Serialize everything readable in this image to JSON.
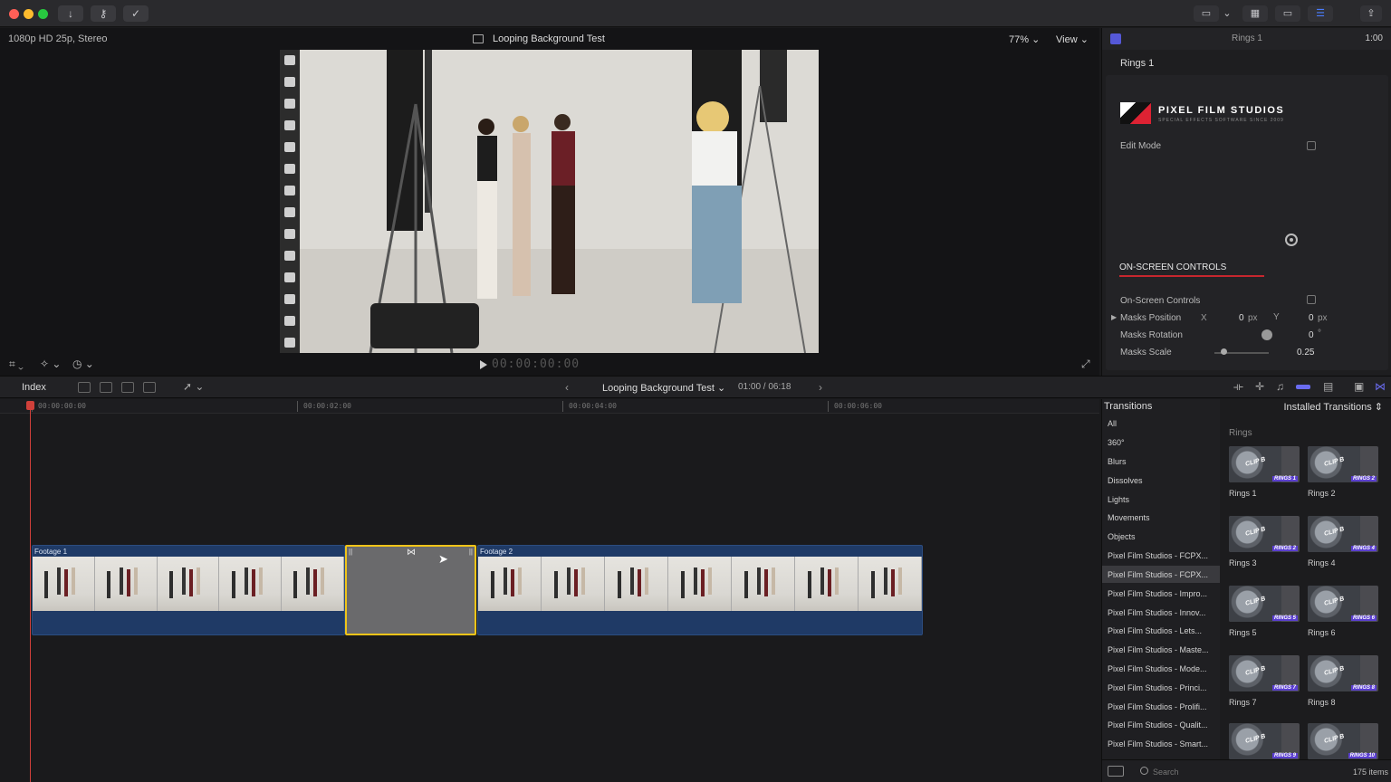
{
  "titlebar": {
    "colors": {
      "close": "#ff5f57",
      "minimize": "#febc2e",
      "maximize": "#28c840"
    }
  },
  "viewer": {
    "format": "1080p HD 25p, Stereo",
    "project_title": "Looping Background Test",
    "zoom": "77%",
    "view_label": "View",
    "timecode": "00:00:00:00"
  },
  "inspector": {
    "header_title": "Rings 1",
    "duration": "1:00",
    "clip_name": "Rings 1",
    "brand": "PIXEL FILM STUDIOS",
    "brand_sub": "SPECIAL EFFECTS SOFTWARE SINCE 2009",
    "edit_mode_label": "Edit Mode",
    "section_title": "ON-SCREEN CONTROLS",
    "on_screen_controls_label": "On-Screen Controls",
    "masks_position_label": "Masks Position",
    "x_label": "X",
    "x_value": "0",
    "y_label": "Y",
    "y_value": "0",
    "px_unit": "px",
    "masks_rotation_label": "Masks Rotation",
    "rotation_value": "0",
    "degree_unit": "°",
    "masks_scale_label": "Masks Scale",
    "scale_value": "0.25"
  },
  "timeline_toolbar": {
    "index_label": "Index",
    "project_name": "Looping Background Test",
    "time": "01:00 / 06:18"
  },
  "timeline": {
    "ruler": [
      "00:00:00:00",
      "00:00:02:00",
      "00:00:04:00",
      "00:00:06:00"
    ],
    "clip1_label": "Footage 1",
    "clip2_label": "Footage 2"
  },
  "browser": {
    "category_header": "Transitions",
    "grid_header": "Installed Transitions",
    "grid_section": "Rings",
    "categories": [
      "All",
      "360°",
      "Blurs",
      "Dissolves",
      "Lights",
      "Movements",
      "Objects",
      "Pixel Film Studios - FCPX...",
      "Pixel Film Studios - FCPX...",
      "Pixel Film Studios - Impro...",
      "Pixel Film Studios - Innov...",
      "Pixel Film Studios - Lets...",
      "Pixel Film Studios - Maste...",
      "Pixel Film Studios - Mode...",
      "Pixel Film Studios - Princi...",
      "Pixel Film Studios - Prolifi...",
      "Pixel Film Studios - Qualit...",
      "Pixel Film Studios - Smart..."
    ],
    "tiles": [
      {
        "name": "Rings 1",
        "tag": "RINGS 1",
        "clip": "CLIP B"
      },
      {
        "name": "Rings 2",
        "tag": "RINGS 2",
        "clip": "CLIP B"
      },
      {
        "name": "Rings 3",
        "tag": "RINGS 2",
        "clip": "CLIP B"
      },
      {
        "name": "Rings 4",
        "tag": "RINGS 4",
        "clip": "CLIP B"
      },
      {
        "name": "Rings 5",
        "tag": "RINGS 5",
        "clip": "CLIP B"
      },
      {
        "name": "Rings 6",
        "tag": "RINGS 6",
        "clip": "CLIP B"
      },
      {
        "name": "Rings 7",
        "tag": "RINGS 7",
        "clip": "CLIP B"
      },
      {
        "name": "Rings 8",
        "tag": "RINGS 8",
        "clip": "CLIP B"
      },
      {
        "name": "",
        "tag": "RINGS 9",
        "clip": "CLIP B"
      },
      {
        "name": "",
        "tag": "RINGS 10",
        "clip": "CLIP B"
      }
    ],
    "search_placeholder": "Search",
    "item_count": "175 items"
  }
}
